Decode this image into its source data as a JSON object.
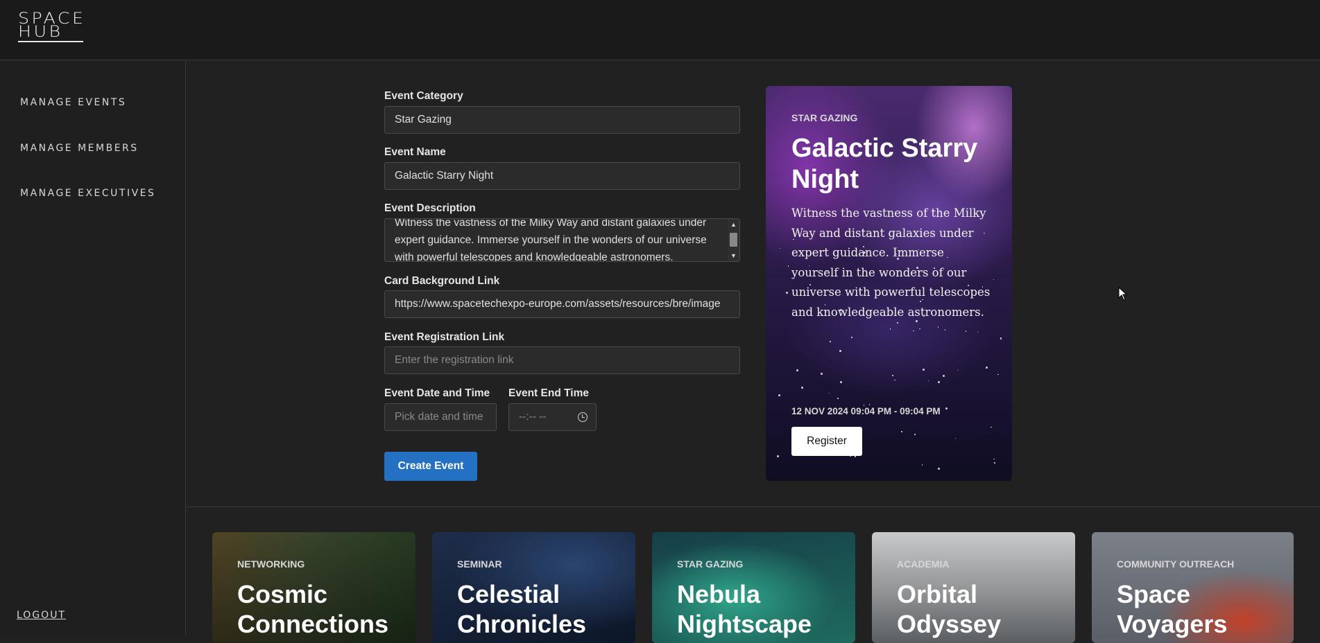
{
  "brand": {
    "line1": "SPACE",
    "line2": "HUB"
  },
  "sidebar": {
    "items": [
      {
        "label": "MANAGE EVENTS"
      },
      {
        "label": "MANAGE MEMBERS"
      },
      {
        "label": "MANAGE EXECUTIVES"
      }
    ],
    "logout_label": "LOGOUT"
  },
  "form": {
    "category_label": "Event Category",
    "category_value": "Star Gazing",
    "name_label": "Event Name",
    "name_value": "Galactic Starry Night",
    "description_label": "Event Description",
    "description_value": "Witness the vastness of the Milky Way and distant galaxies under expert guidance. Immerse yourself in the wonders of our universe with powerful telescopes and knowledgeable astronomers.",
    "background_label": "Card Background Link",
    "background_value": "https://www.spacetechexpo-europe.com/assets/resources/bre/image",
    "registration_label": "Event Registration Link",
    "registration_placeholder": "Enter the registration link",
    "datetime_label": "Event Date and Time",
    "datetime_placeholder": "Pick date and time",
    "endtime_label": "Event End Time",
    "endtime_placeholder": "--:-- --",
    "submit_label": "Create Event"
  },
  "preview": {
    "category": "STAR GAZING",
    "title": "Galactic Starry Night",
    "description": "Witness the vastness of the Milky Way and distant galaxies under expert guidance. Immerse yourself in the wonders of our universe with powerful telescopes and knowledgeable astronomers.",
    "date": "12 NOV 2024 09:04 PM - 09:04 PM",
    "register_label": "Register"
  },
  "event_cards": [
    {
      "category": "NETWORKING",
      "title": "Cosmic Connections",
      "color": "#4a5a3a"
    },
    {
      "category": "SEMINAR",
      "title": "Celestial Chronicles",
      "color": "#1e2d4a"
    },
    {
      "category": "STAR GAZING",
      "title": "Nebula Nightscape",
      "color": "#1f6a5e"
    },
    {
      "category": "ACADEMIA",
      "title": "Orbital Odyssey",
      "color": "#8a8c8e"
    },
    {
      "category": "COMMUNITY OUTREACH",
      "title": "Space Voyagers",
      "color": "#5a5e66"
    }
  ]
}
